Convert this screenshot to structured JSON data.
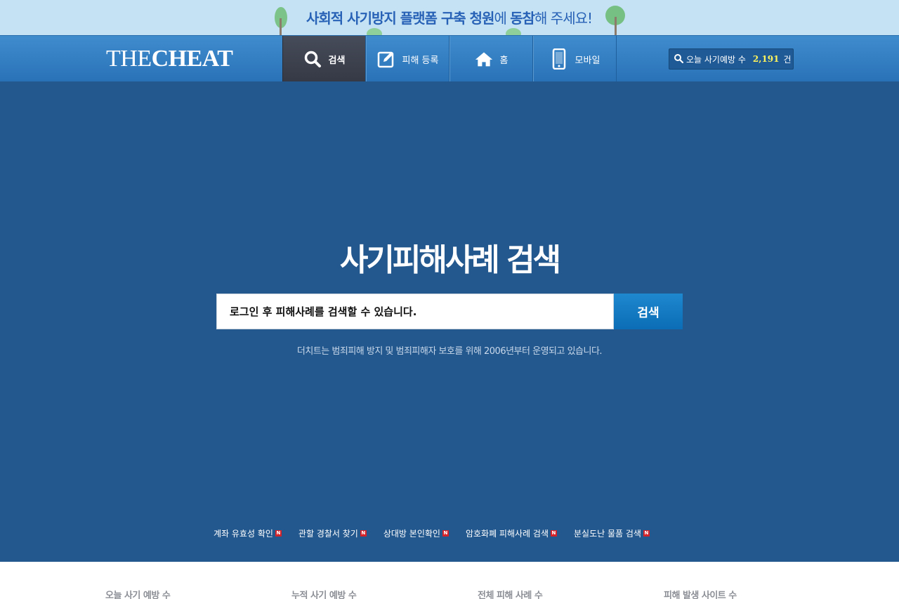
{
  "banner": {
    "text_bold": "사회적 사기방지 플랫폼 구축 청원",
    "text_mid": "에 ",
    "text_bold2": "동참",
    "text_end": "해 주세요!"
  },
  "header": {
    "logo_light": "THE",
    "logo_bold": "CHEAT",
    "nav": [
      {
        "label": "검색",
        "icon": "search-icon"
      },
      {
        "label": "피해 등록",
        "icon": "edit-icon"
      },
      {
        "label": "홈",
        "icon": "home-icon"
      },
      {
        "label": "모바일",
        "icon": "mobile-icon"
      }
    ],
    "counter": {
      "label": "오늘 사기예방 수",
      "value": "2,191",
      "unit": "건"
    }
  },
  "hero": {
    "title": "사기피해사례 검색",
    "search_placeholder": "로그인 후 피해사례를 검색할 수 있습니다.",
    "search_button": "검색",
    "subtitle": "더치트는 범죄피해 방지 및 범죄피해자 보호를 위해 2006년부터 운영되고 있습니다."
  },
  "quick_links": [
    {
      "label": "계좌 유효성 확인",
      "badge": "N"
    },
    {
      "label": "관할 경찰서 찾기",
      "badge": "N"
    },
    {
      "label": "상대방 본인확인",
      "badge": "N"
    },
    {
      "label": "암호화폐 피해사례 검색",
      "badge": "N"
    },
    {
      "label": "분실도난 물품 검색",
      "badge": "N"
    }
  ],
  "stats": [
    {
      "label": "오늘 사기 예방 수"
    },
    {
      "label": "누적 사기 예방 수"
    },
    {
      "label": "전체 피해 사례 수"
    },
    {
      "label": "피해 발생 사이트 수"
    }
  ],
  "colors": {
    "hero_bg": "#23588e",
    "header_bg": "#2a72b8",
    "banner_bg": "#c4e2f4",
    "accent_button": "#0b6db5",
    "counter_value": "#fff45c"
  }
}
